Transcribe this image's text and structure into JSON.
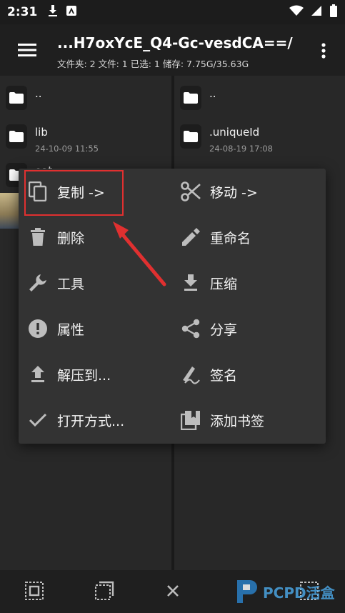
{
  "status_bar": {
    "time": "2:31"
  },
  "app_bar": {
    "title": "...H7oxYcE_Q4-Gc-vesdCA==/",
    "subtitle": "文件夹: 2  文件: 1  已选: 1  储存: 7.75G/35.63G"
  },
  "left_pane": {
    "items": [
      {
        "name": "..",
        "date": ""
      },
      {
        "name": "lib",
        "date": "24-10-09 11:55"
      },
      {
        "name": "oat",
        "date": ""
      }
    ]
  },
  "right_pane": {
    "items": [
      {
        "name": "..",
        "date": ""
      },
      {
        "name": ".uniqueId",
        "date": "24-08-19 17:08"
      }
    ]
  },
  "context_menu": {
    "left": [
      {
        "label": "复制 ->",
        "icon": "copy-icon"
      },
      {
        "label": "删除",
        "icon": "delete-icon"
      },
      {
        "label": "工具",
        "icon": "wrench-icon"
      },
      {
        "label": "属性",
        "icon": "info-icon"
      },
      {
        "label": "解压到...",
        "icon": "upload-icon"
      },
      {
        "label": "打开方式...",
        "icon": "check-icon"
      }
    ],
    "right": [
      {
        "label": "移动 ->",
        "icon": "scissors-icon"
      },
      {
        "label": "重命名",
        "icon": "pencil-icon"
      },
      {
        "label": "压缩",
        "icon": "download-icon"
      },
      {
        "label": "分享",
        "icon": "share-icon"
      },
      {
        "label": "签名",
        "icon": "signature-icon"
      },
      {
        "label": "添加书签",
        "icon": "bookmark-icon"
      }
    ]
  },
  "watermark": {
    "text": "PCPD活盒"
  },
  "colors": {
    "highlight": "#e03030",
    "accent": "#4aa3e0"
  }
}
